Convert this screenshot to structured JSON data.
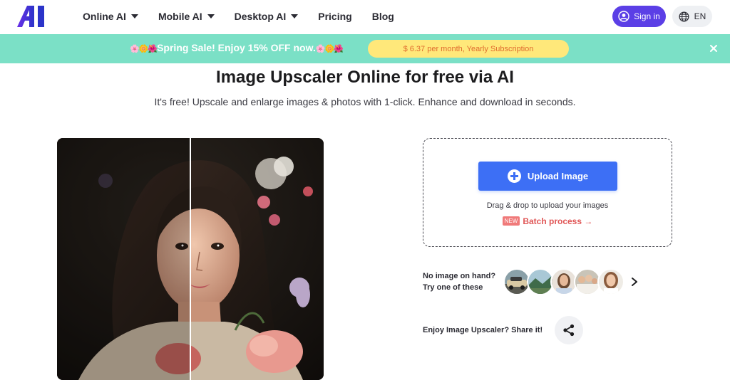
{
  "header": {
    "logo_text": "AI",
    "nav": [
      {
        "label": "Online AI",
        "has_dropdown": true
      },
      {
        "label": "Mobile AI",
        "has_dropdown": true
      },
      {
        "label": "Desktop AI",
        "has_dropdown": true
      },
      {
        "label": "Pricing",
        "has_dropdown": false
      },
      {
        "label": "Blog",
        "has_dropdown": false
      }
    ],
    "signin_label": "Sign in",
    "signin_icon": "user-circle-icon",
    "language_label": "EN",
    "language_icon": "globe-icon"
  },
  "promo": {
    "flowers_left": "🌸🌼🌺",
    "text": "Spring Sale! Enjoy 15% OFF now.",
    "flowers_right": "🌸🌼🌺",
    "offer_label": "$ 6.37 per month, Yearly Subscription",
    "close_icon": "close-icon"
  },
  "hero": {
    "title": "Image Upscaler Online for free via AI",
    "subtitle": "It's free! Upscale and enlarge images & photos with 1-click. Enhance and download in seconds."
  },
  "upload": {
    "button_label": "Upload Image",
    "drag_text": "Drag & drop to upload your images",
    "new_badge": "NEW",
    "batch_label": "Batch process →"
  },
  "samples": {
    "line1": "No image on hand?",
    "line2": "Try one of these",
    "thumbnails": [
      "car-sample",
      "landscape-sample",
      "woman-sample",
      "group-sample",
      "portrait-sample"
    ]
  },
  "share": {
    "label": "Enjoy Image Upscaler? Share it!",
    "icon": "share-icon"
  },
  "colors": {
    "accent": "#5b3fe6",
    "upload_blue": "#3d6ff5",
    "promo_bg": "#7be0c6",
    "promo_button": "#ffe87a",
    "batch_red": "#e05656"
  }
}
